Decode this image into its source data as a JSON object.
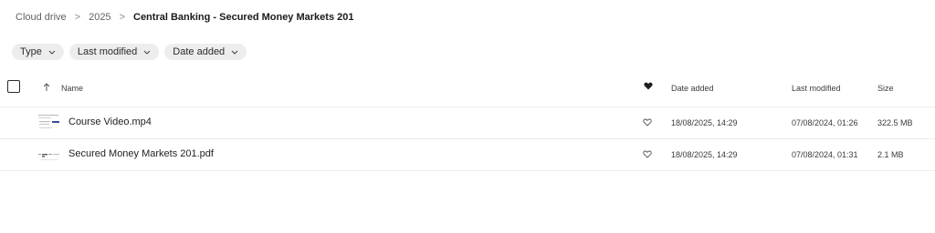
{
  "breadcrumb": {
    "items": [
      "Cloud drive",
      "2025",
      "Central Banking - Secured Money Markets 201"
    ],
    "separator": ">"
  },
  "filters": [
    {
      "label": "Type"
    },
    {
      "label": "Last modified"
    },
    {
      "label": "Date added"
    }
  ],
  "table": {
    "columns": {
      "name": "Name",
      "date_added": "Date added",
      "last_modified": "Last modified",
      "size": "Size"
    },
    "rows": [
      {
        "name": "Course Video.mp4",
        "date_added": "18/08/2025, 14:29",
        "last_modified": "07/08/2024, 01:26",
        "size": "322.5 MB",
        "thumbnail": "video-thumbnail"
      },
      {
        "name": "Secured Money Markets 201.pdf",
        "date_added": "18/08/2025, 14:29",
        "last_modified": "07/08/2024, 01:31",
        "size": "2.1 MB",
        "thumbnail": "pdf-thumbnail"
      }
    ]
  },
  "icons": {
    "sort": "arrow-up-icon",
    "favourite_header": "heart-filled-icon",
    "favourite_row": "heart-outline-icon",
    "chip": "chevron-down-icon"
  }
}
